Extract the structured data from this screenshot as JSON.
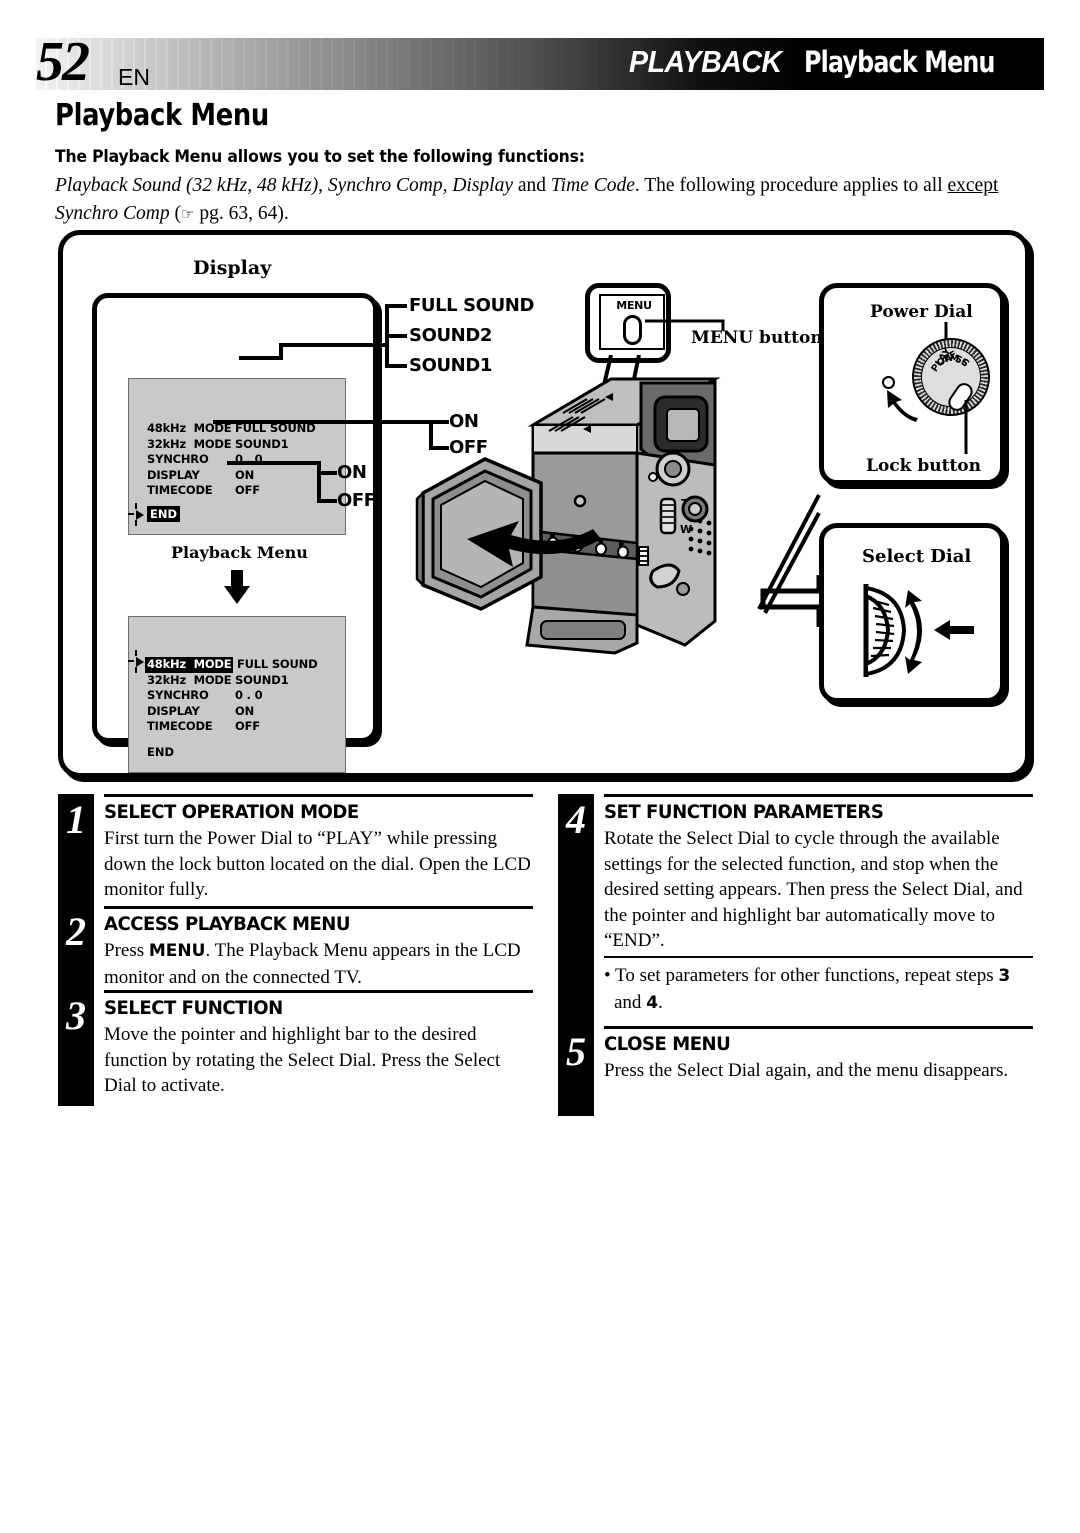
{
  "header": {
    "page_number": "52",
    "language": "EN",
    "chapter": "PLAYBACK",
    "section": "Playback Menu"
  },
  "intro": {
    "title": "Playback Menu",
    "lead": "The Playback Menu allows you to set the following functions:",
    "body_part1": "Playback Sound (32 kHz, 48 kHz), Synchro Comp, Display",
    "body_and": " and ",
    "body_part2": "Time Code",
    "body_part3": ". The following procedure applies to all ",
    "body_except": "except",
    "body_part4": " Synchro Comp",
    "body_pg": " pg. 63, 64)."
  },
  "diagram": {
    "display_label": "Display",
    "playback_menu_label": "Playback Menu",
    "menu_button_label": "MENU button",
    "menu_key_text": "MENU",
    "power_dial_label": "Power Dial",
    "lock_button_label": "Lock button",
    "select_dial_label": "Select Dial",
    "dial_marks": [
      "PLAY",
      "OFF",
      "A",
      "M",
      "5S",
      "C"
    ],
    "screen1": {
      "rows": [
        {
          "key": "48kHz  MODE",
          "value": "FULL SOUND"
        },
        {
          "key": "32kHz  MODE",
          "value": "SOUND1"
        },
        {
          "key": "SYNCHRO",
          "value": "0 . 0"
        },
        {
          "key": "DISPLAY",
          "value": "ON"
        },
        {
          "key": "TIMECODE",
          "value": "OFF"
        }
      ],
      "end": "END",
      "end_highlighted": true,
      "highlight_row": -1
    },
    "screen2": {
      "rows": [
        {
          "key": "48kHz  MODE",
          "value": "FULL SOUND"
        },
        {
          "key": "32kHz  MODE",
          "value": "SOUND1"
        },
        {
          "key": "SYNCHRO",
          "value": "0 . 0"
        },
        {
          "key": "DISPLAY",
          "value": "ON"
        },
        {
          "key": "TIMECODE",
          "value": "OFF"
        }
      ],
      "end": "END",
      "end_highlighted": false,
      "highlight_row": 0
    },
    "sound_options": [
      "FULL SOUND",
      "SOUND2",
      "SOUND1"
    ],
    "display_options": [
      "ON",
      "OFF"
    ],
    "timecode_options": [
      "ON",
      "OFF"
    ]
  },
  "steps": {
    "left": [
      {
        "number": "1",
        "heading": "SELECT OPERATION MODE",
        "body": "First turn the Power Dial to “PLAY” while pressing down the lock button located on the dial. Open the LCD monitor fully."
      },
      {
        "number": "2",
        "heading": "ACCESS PLAYBACK MENU",
        "body_pre": "Press ",
        "body_bold": "MENU",
        "body_post": ". The Playback Menu appears in the LCD monitor and on the connected TV."
      },
      {
        "number": "3",
        "heading": "SELECT FUNCTION",
        "body": "Move the pointer and highlight bar to the desired function by rotating the Select Dial. Press the Select Dial to activate."
      }
    ],
    "right": [
      {
        "number": "4",
        "heading": "SET FUNCTION PARAMETERS",
        "body": "Rotate the Select Dial to cycle through the available settings for the selected function, and stop when the desired setting appears. Then press the Select Dial, and the pointer and highlight bar automatically move to “END”."
      },
      {
        "number": "5",
        "heading": "CLOSE MENU",
        "body": "Press the Select Dial again, and the menu disappears."
      }
    ],
    "bullet_pre": "• To set parameters for other functions, repeat steps ",
    "bullet_b1": "3",
    "bullet_mid": " and ",
    "bullet_b2": "4",
    "bullet_post": "."
  },
  "colors": {
    "ink": "#000000",
    "lcd_background": "#c9c9c9",
    "dial_face": "#dedede"
  }
}
